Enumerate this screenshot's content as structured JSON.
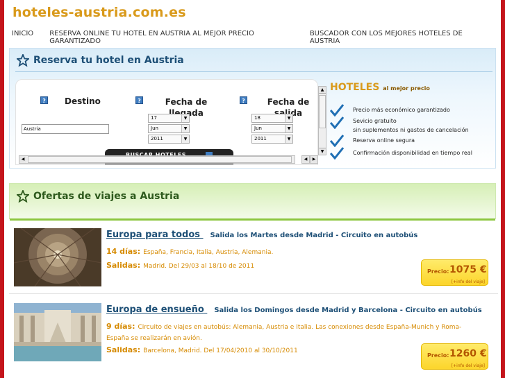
{
  "header": {
    "site_title": "hoteles-austria.com.es"
  },
  "nav": {
    "items": [
      "INICIO",
      "RESERVA ONLINE TU HOTEL EN AUSTRIA AL MEJOR PRECIO GARANTIZADO",
      "BUSCADOR CON LOS MEJORES HOTELES DE AUSTRIA"
    ]
  },
  "booking": {
    "title": "Reserva tu hotel en Austria",
    "destino_label": "Destino",
    "llegada_label": "Fecha de llegada",
    "salida_label": "Fecha de salida",
    "destino_value": "Austria",
    "llegada": {
      "day": "17",
      "month": "Jun",
      "year": "2011"
    },
    "salida": {
      "day": "18",
      "month": "Jun",
      "year": "2011"
    },
    "search_button": "BUSCAR HOTELES",
    "help_icon": "?"
  },
  "hoteles_box": {
    "title": "HOTELES",
    "subtitle": "al mejor precio",
    "features": [
      "Precio más económico garantizado",
      "Sevicio gratuito",
      "sin suplementos ni gastos de cancelación",
      "Reserva online segura",
      "Confirmación disponibilidad en tiempo real"
    ]
  },
  "offers": {
    "title": "Ofertas de viajes a Austria",
    "items": [
      {
        "name": "Europa para todos",
        "subtitle": "Salida los Martes desde Madrid - Circuito en autobús",
        "dias_label": "14 días:",
        "dias_text": "España, Francia, Italia, Austria, Alemania.",
        "salidas_label": "Salidas:",
        "salidas_text": "Madrid. Del 29/03 al 18/10 de 2011",
        "price_label": "Precio:",
        "price": "1075 €",
        "info": "[+info del viaje]"
      },
      {
        "name": "Europa de ensueño",
        "subtitle": "Salida los Domingos desde Madrid y Barcelona - Circuito en autobús",
        "dias_label": "9 días:",
        "dias_text": "Circuito de viajes en autobús: Alemania, Austria e Italia. Las conexiones desde España-Munich y Roma-España se realizarán en avión.",
        "salidas_label": "Salidas:",
        "salidas_text": "Barcelona, Madrid. Del 17/04/2010 al 30/10/2011",
        "price_label": "Precio:",
        "price": "1260 €",
        "info": "[+info del viaje]"
      }
    ]
  },
  "colors": {
    "brand_red": "#c4141b",
    "title_orange": "#d99a1b",
    "nav_blue": "#1d4f76",
    "check_blue": "#1f6fb4"
  }
}
